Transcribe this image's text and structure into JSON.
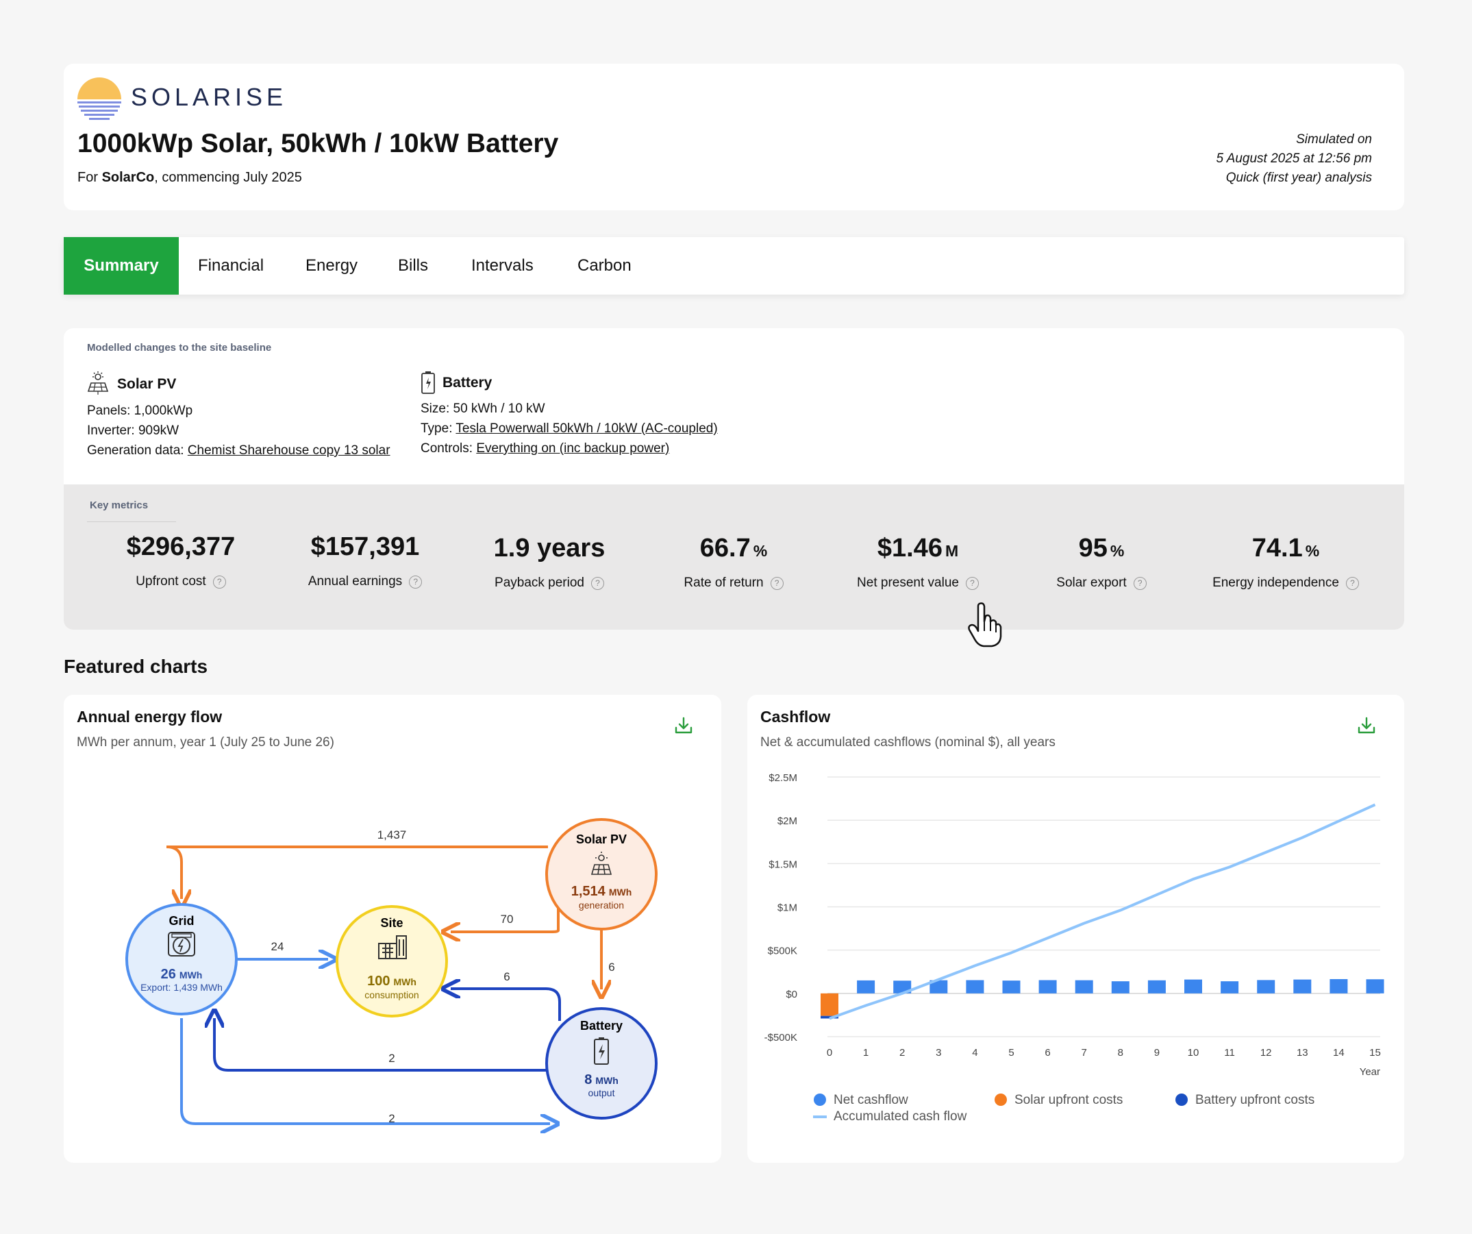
{
  "header": {
    "brand": "SOLARISE",
    "title": "1000kWp Solar, 50kWh / 10kW Battery",
    "subtitle_prefix": "For ",
    "subtitle_company": "SolarCo",
    "subtitle_suffix": ", commencing July 2025",
    "sim_line1": "Simulated on",
    "sim_line2": "5 August 2025 at 12:56 pm",
    "sim_line3": "Quick (first year) analysis"
  },
  "tabs": [
    "Summary",
    "Financial",
    "Energy",
    "Bills",
    "Intervals",
    "Carbon"
  ],
  "changes": {
    "label": "Modelled changes to the site baseline",
    "solar": {
      "title": "Solar PV",
      "panels": "Panels: 1,000kWp",
      "inverter": "Inverter: 909kW",
      "gen_prefix": "Generation data: ",
      "gen_link": "Chemist Sharehouse copy 13 solar"
    },
    "battery": {
      "title": "Battery",
      "size": "Size: 50 kWh / 10 kW",
      "type_prefix": "Type: ",
      "type_link": "Tesla Powerwall 50kWh / 10kW (AC-coupled)",
      "controls_prefix": "Controls: ",
      "controls_link": "Everything on (inc backup power)"
    }
  },
  "key_metrics": {
    "label": "Key metrics",
    "items": [
      {
        "value": "$296,377",
        "unit": "",
        "label": "Upfront cost"
      },
      {
        "value": "$157,391",
        "unit": "",
        "label": "Annual earnings"
      },
      {
        "value": "1.9 years",
        "unit": "",
        "label": "Payback period"
      },
      {
        "value": "66.7",
        "unit": "%",
        "label": "Rate of return"
      },
      {
        "value": "$1.46",
        "unit": "M",
        "label": "Net present value"
      },
      {
        "value": "95",
        "unit": "%",
        "label": "Solar export"
      },
      {
        "value": "74.1",
        "unit": "%",
        "label": "Energy independence"
      }
    ]
  },
  "featured": {
    "heading": "Featured charts",
    "flow": {
      "title": "Annual energy flow",
      "subtitle": "MWh per annum, year 1 (July 25 to June 26)",
      "nodes": {
        "grid": {
          "name": "Grid",
          "value": "26",
          "unit": "MWh",
          "note": "Export: 1,439 MWh"
        },
        "site": {
          "name": "Site",
          "value": "100",
          "unit": "MWh",
          "note": "consumption"
        },
        "solar": {
          "name": "Solar PV",
          "value": "1,514",
          "unit": "MWh",
          "note": "generation"
        },
        "battery": {
          "name": "Battery",
          "value": "8",
          "unit": "MWh",
          "note": "output"
        }
      },
      "edges": {
        "solar_grid": "1,437",
        "solar_site": "70",
        "grid_site": "24",
        "solar_battery": "6",
        "battery_site": "6",
        "battery_grid": "2",
        "grid_battery": "2"
      },
      "colors": {
        "solar": "#f07f2c",
        "grid": "#4f8fef",
        "site": "#f2cf1f",
        "battery": "#1e44c0"
      }
    },
    "cash": {
      "title": "Cashflow",
      "subtitle": "Net & accumulated cashflows (nominal $), all years"
    }
  },
  "chart_data": {
    "type": "bar",
    "categories": [
      "0",
      "1",
      "2",
      "3",
      "4",
      "5",
      "6",
      "7",
      "8",
      "9",
      "10",
      "11",
      "12",
      "13",
      "14",
      "15"
    ],
    "xlabel": "Year",
    "ylabel": "",
    "ylim": [
      -500000,
      2500000
    ],
    "y_ticks": [
      {
        "v": 2500000,
        "label": "$2.5M"
      },
      {
        "v": 2000000,
        "label": "$2M"
      },
      {
        "v": 1500000,
        "label": "$1.5M"
      },
      {
        "v": 1000000,
        "label": "$1M"
      },
      {
        "v": 500000,
        "label": "$500K"
      },
      {
        "v": 0,
        "label": "$0"
      },
      {
        "v": -500000,
        "label": "-$500K"
      }
    ],
    "grid": true,
    "legend_position": "bottom-left",
    "series": [
      {
        "name": "Net cashflow",
        "type": "bar",
        "color": "#3b86ee",
        "values": [
          null,
          150000,
          147000,
          152000,
          153000,
          148000,
          153000,
          152000,
          140000,
          151000,
          160000,
          140000,
          154000,
          160000,
          165000,
          163000
        ]
      },
      {
        "name": "Solar upfront costs",
        "type": "bar",
        "color": "#f47c20",
        "values": [
          -260000,
          null,
          null,
          null,
          null,
          null,
          null,
          null,
          null,
          null,
          null,
          null,
          null,
          null,
          null,
          null
        ]
      },
      {
        "name": "Battery upfront costs",
        "type": "bar",
        "color": "#1a4fc2",
        "values": [
          -30000,
          null,
          null,
          null,
          null,
          null,
          null,
          null,
          null,
          null,
          null,
          null,
          null,
          null,
          null,
          null
        ]
      },
      {
        "name": "Accumulated cash flow",
        "type": "line",
        "color": "#8ec4fb",
        "values": [
          -290000,
          -140000,
          0,
          160000,
          320000,
          470000,
          640000,
          810000,
          960000,
          1140000,
          1320000,
          1460000,
          1630000,
          1800000,
          1990000,
          2180000
        ]
      }
    ]
  }
}
